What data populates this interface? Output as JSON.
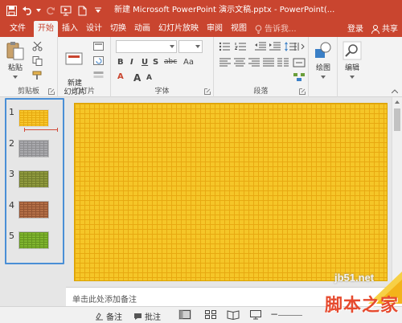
{
  "window": {
    "title": "新建 Microsoft PowerPoint 演示文稿.pptx - PowerPoint(..."
  },
  "tabs": [
    {
      "label": "文件"
    },
    {
      "label": "开始"
    },
    {
      "label": "插入"
    },
    {
      "label": "设计"
    },
    {
      "label": "切换"
    },
    {
      "label": "动画"
    },
    {
      "label": "幻灯片放映"
    },
    {
      "label": "审阅"
    },
    {
      "label": "视图"
    }
  ],
  "tab_right": {
    "search": "告诉我...",
    "login": "登录",
    "share": "共享"
  },
  "ribbon": {
    "clipboard": {
      "paste_label": "粘贴",
      "group_label": "剪贴板"
    },
    "slides": {
      "new_slide_label": "新建\n幻灯片",
      "group_label": "幻灯片"
    },
    "font": {
      "group_label": "字体",
      "bold": "B",
      "italic": "I",
      "underline": "U",
      "strike": "S",
      "abc": "abc",
      "aa": "Aa",
      "font_a": "A",
      "font_a_small": "A"
    },
    "paragraph": {
      "group_label": "段落"
    },
    "drawing": {
      "label": "绘图"
    },
    "editing": {
      "label": "编辑"
    }
  },
  "thumbnails": [
    {
      "number": "1",
      "color": "#f7c52a",
      "line": "#e6a90f"
    },
    {
      "number": "2",
      "color": "#a9a9ad",
      "line": "#8d8d90"
    },
    {
      "number": "3",
      "color": "#8f9a3e",
      "line": "#727c2c"
    },
    {
      "number": "4",
      "color": "#b46f47",
      "line": "#935433"
    },
    {
      "number": "5",
      "color": "#7fb52e",
      "line": "#659420"
    }
  ],
  "notes": {
    "placeholder": "单击此处添加备注"
  },
  "statusbar": {
    "notes_label": "备注",
    "comments_label": "批注"
  },
  "watermark": {
    "url": "jb51.net",
    "text": "脚本之家"
  },
  "colors": {
    "accent": "#c9452f",
    "selection_frame": "#4a8fd6",
    "slide_fill": "#f5c628"
  }
}
